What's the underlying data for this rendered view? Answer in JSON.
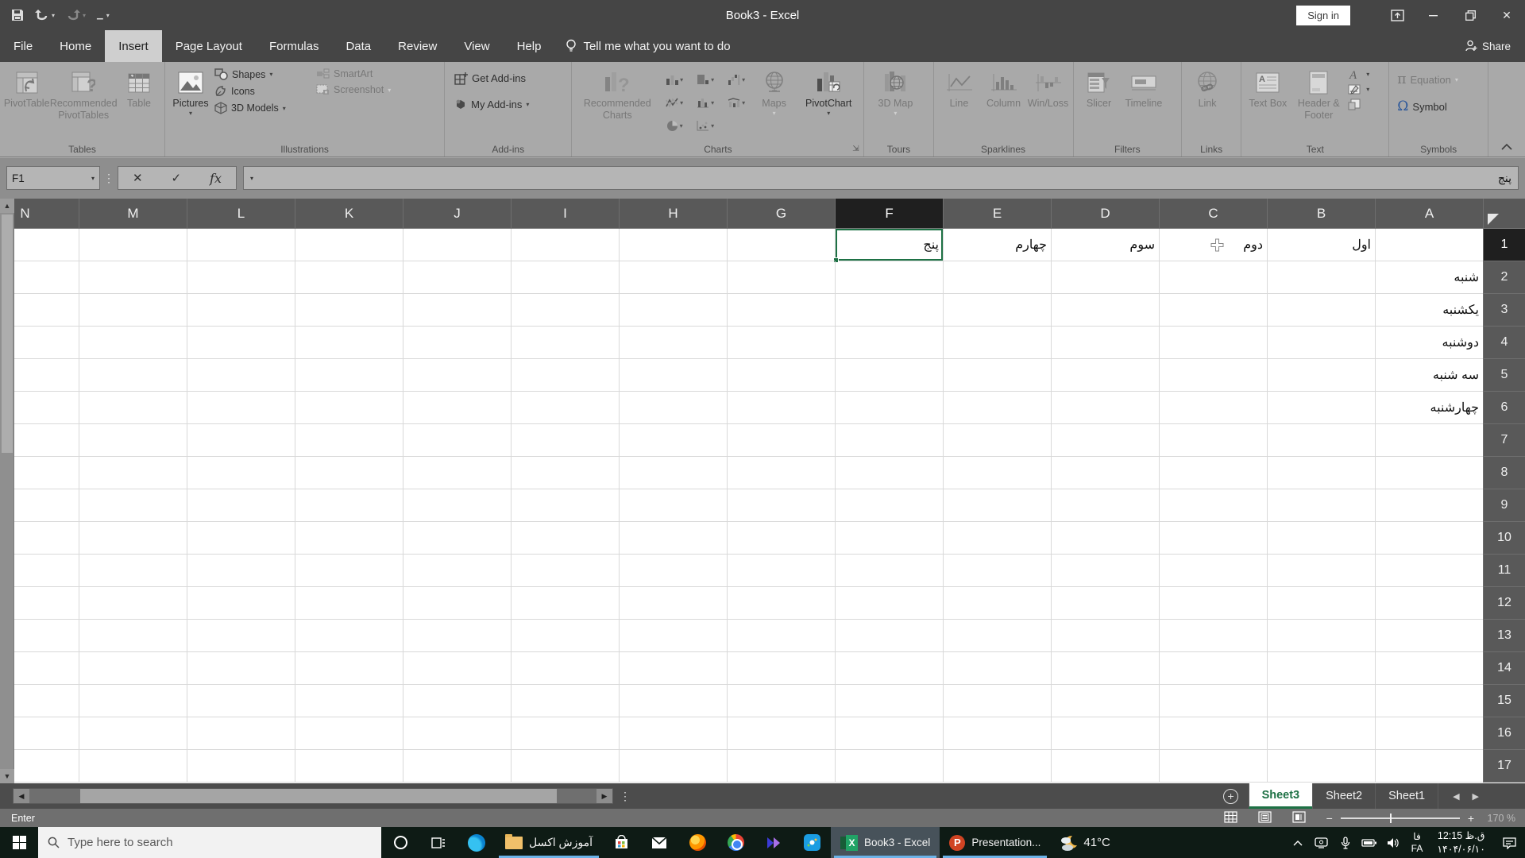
{
  "window": {
    "title": "Book3  -  Excel",
    "sign_in_label": "Sign in"
  },
  "ribbon": {
    "tabs": [
      "File",
      "Home",
      "Insert",
      "Page Layout",
      "Formulas",
      "Data",
      "Review",
      "View",
      "Help"
    ],
    "active_tab": "Insert",
    "tell_me_label": "Tell me what you want to do",
    "share_label": "Share",
    "groups": {
      "tables": {
        "label": "Tables",
        "pivottable": "PivotTable",
        "recommended": "Recommended PivotTables",
        "table": "Table"
      },
      "illustrations": {
        "label": "Illustrations",
        "pictures": "Pictures",
        "shapes": "Shapes",
        "icons": "Icons",
        "models": "3D Models",
        "smartart": "SmartArt",
        "screenshot": "Screenshot"
      },
      "addins": {
        "label": "Add-ins",
        "get": "Get Add-ins",
        "my": "My Add-ins"
      },
      "charts": {
        "label": "Charts",
        "recommended": "Recommended Charts",
        "maps": "Maps",
        "pivotchart": "PivotChart"
      },
      "tours": {
        "label": "Tours",
        "map3d": "3D Map"
      },
      "sparklines": {
        "label": "Sparklines",
        "line": "Line",
        "column": "Column",
        "winloss": "Win/Loss"
      },
      "filters": {
        "label": "Filters",
        "slicer": "Slicer",
        "timeline": "Timeline"
      },
      "links": {
        "label": "Links",
        "link": "Link"
      },
      "text": {
        "label": "Text",
        "textbox": "Text Box",
        "headerfooter": "Header & Footer"
      },
      "symbols": {
        "label": "Symbols",
        "equation": "Equation",
        "symbol": "Symbol",
        "pi": "π",
        "omega": "Ω"
      }
    }
  },
  "formula_bar": {
    "name_box": "F1",
    "content": "پنج"
  },
  "grid": {
    "columns": [
      "A",
      "B",
      "C",
      "D",
      "E",
      "F",
      "G",
      "H",
      "I",
      "J",
      "K",
      "L",
      "M",
      "N"
    ],
    "visible_rows": 17,
    "selected_cell": "F1",
    "selected_column": "F",
    "selected_row": 1,
    "cells": {
      "B1": "اول",
      "C1": "دوم",
      "D1": "سوم",
      "E1": "چهارم",
      "F1": "پنج",
      "A2": "شنبه",
      "A3": "یکشنبه",
      "A4": "دوشنبه",
      "A5": "سه شنبه",
      "A6": "چهارشنبه"
    }
  },
  "sheet_tabs": {
    "tabs": [
      "Sheet3",
      "Sheet2",
      "Sheet1"
    ],
    "active": "Sheet3"
  },
  "status_bar": {
    "mode": "Enter",
    "zoom_level": "170 %"
  },
  "taskbar": {
    "search_placeholder": "Type here to search",
    "folder_button": "آموزش اکسل",
    "excel_button": "Book3 - Excel",
    "powerpoint_button": "Presentation...",
    "weather": "41°C",
    "lang_line1": "فا",
    "lang_line2": "FA",
    "clock_time": "12:15 ق.ظ",
    "clock_date": "۱۴۰۴/۰۶/۱۰"
  },
  "colors": {
    "excel_green": "#1e7145",
    "titlebar": "#454545",
    "ribbon": "#a9a9a9",
    "taskbar": "#0e1b15",
    "open_app_indicator": "#6cb3e8"
  }
}
